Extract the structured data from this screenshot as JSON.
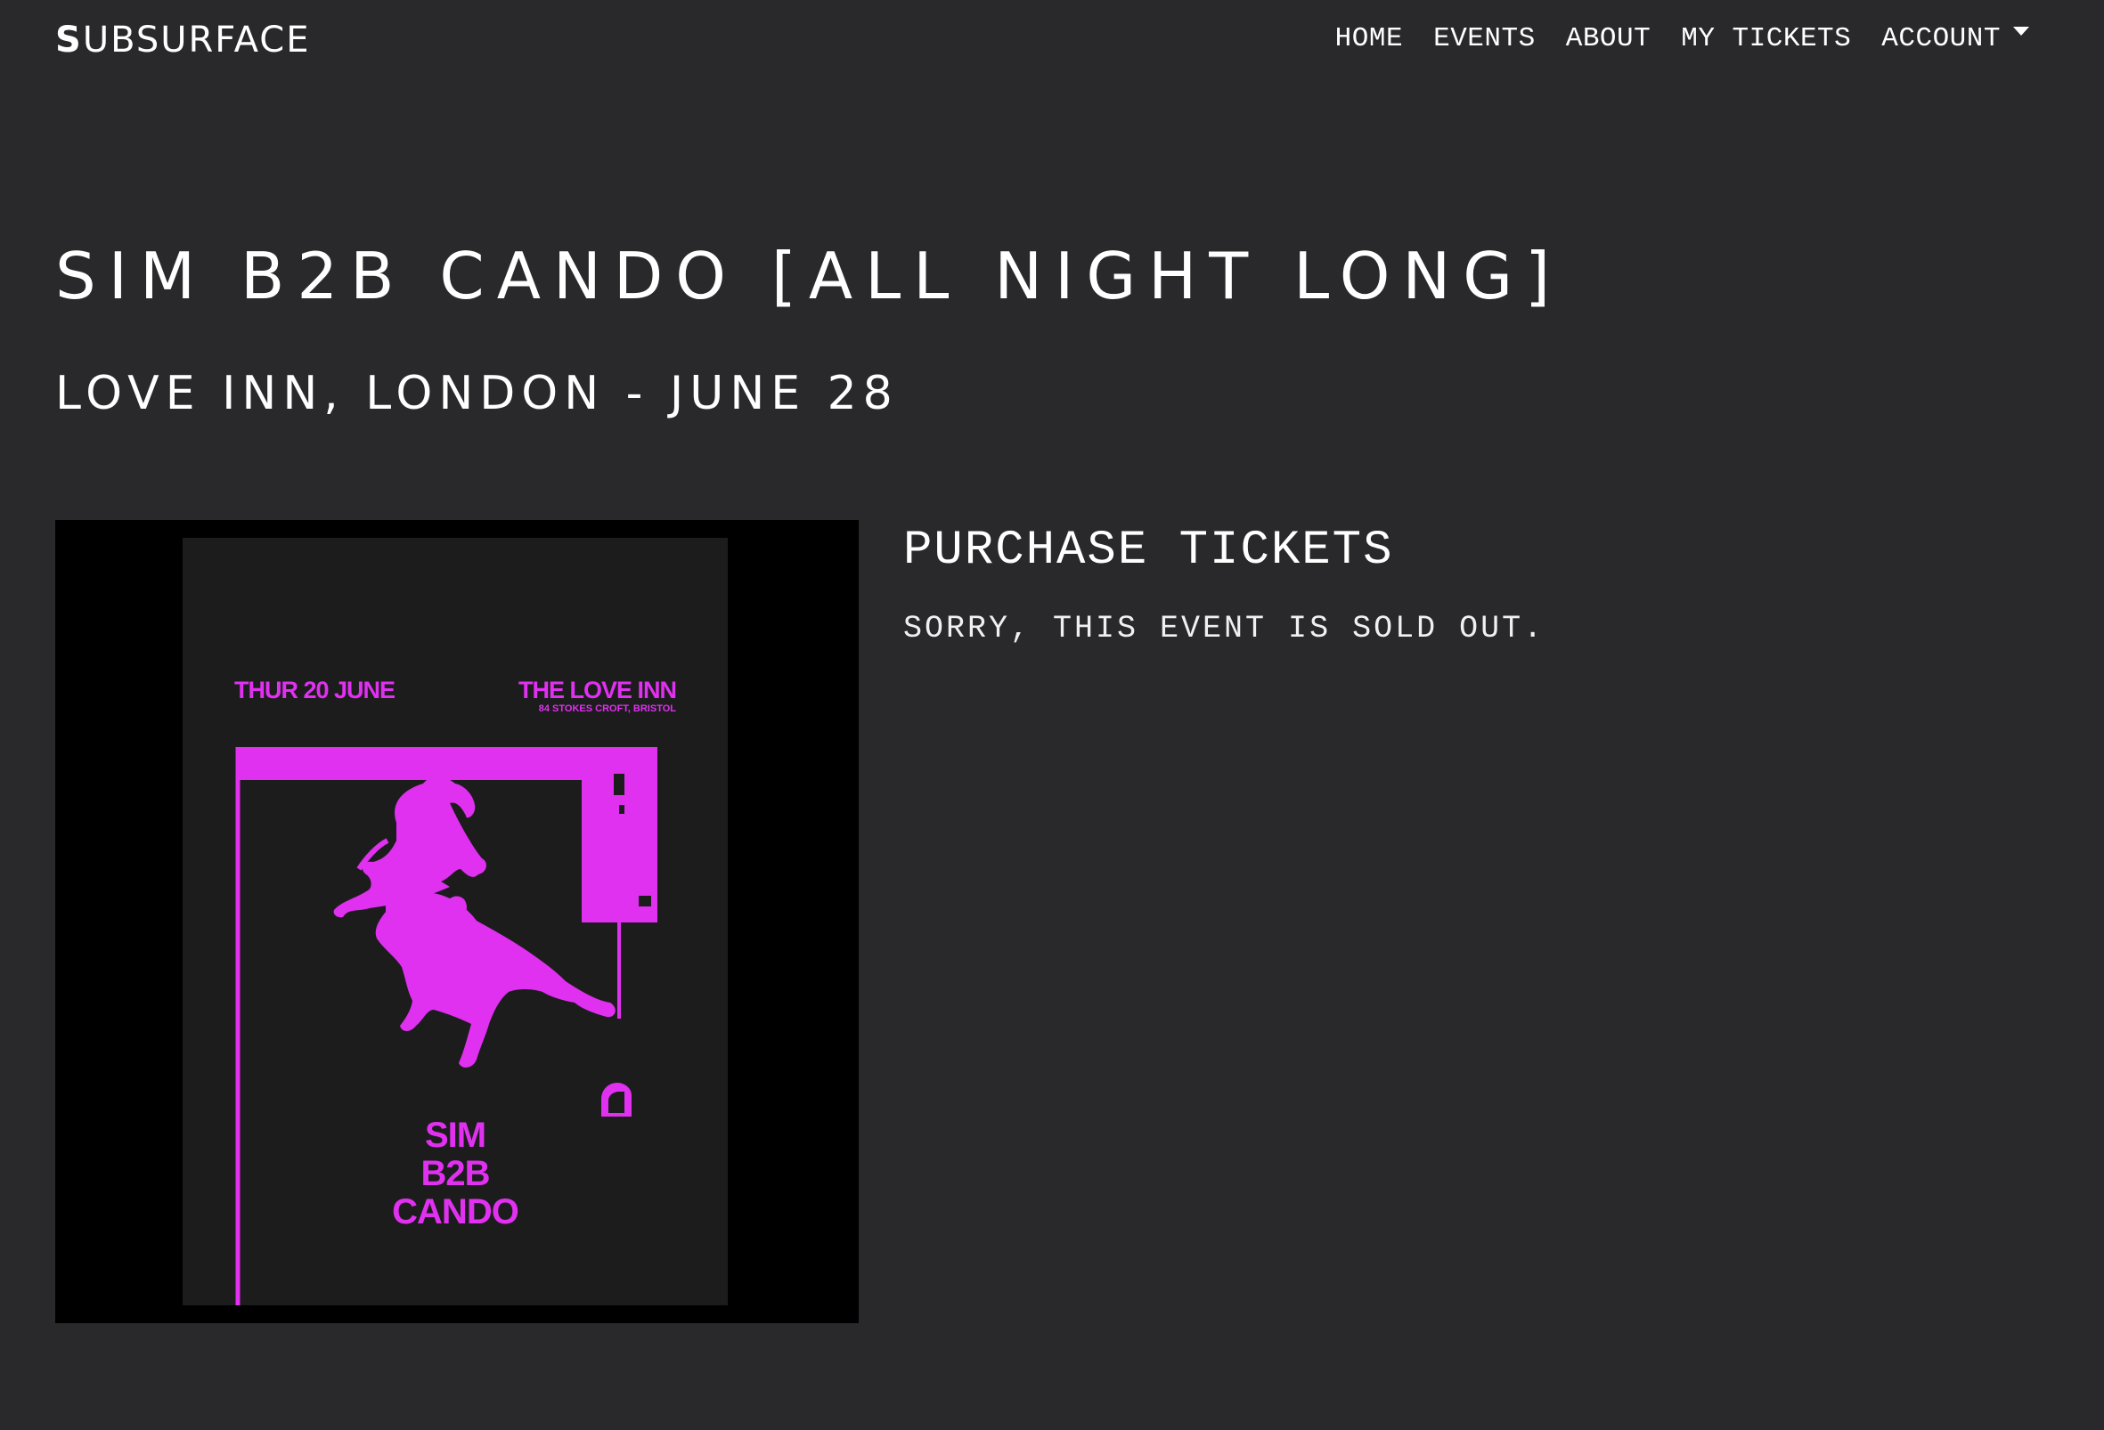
{
  "nav": {
    "brand_first": "S",
    "brand_rest": "UBSURFACE",
    "links": {
      "home": "HOME",
      "events": "EVENTS",
      "about": "ABOUT",
      "my_tickets": "MY TICKETS",
      "account": "ACCOUNT"
    },
    "account_icon": "caret-down-icon"
  },
  "event": {
    "title": "SIM B2B CANDO [ALL NIGHT LONG]",
    "subtitle": "LOVE INN, LONDON - JUNE 28"
  },
  "poster": {
    "date": "THUR 20 JUNE",
    "venue": "THE LOVE INN",
    "address": "84 STOKES CROFT, BRISTOL",
    "names": [
      "SIM",
      "B2B",
      "CANDO"
    ],
    "accent_color": "#e030f0"
  },
  "purchase": {
    "heading": "PURCHASE TICKETS",
    "message": "SORRY, THIS EVENT IS SOLD OUT."
  },
  "colors": {
    "background": "#29292c",
    "text": "#ffffff",
    "poster_frame": "#000000",
    "poster_accent": "#e030f0"
  }
}
